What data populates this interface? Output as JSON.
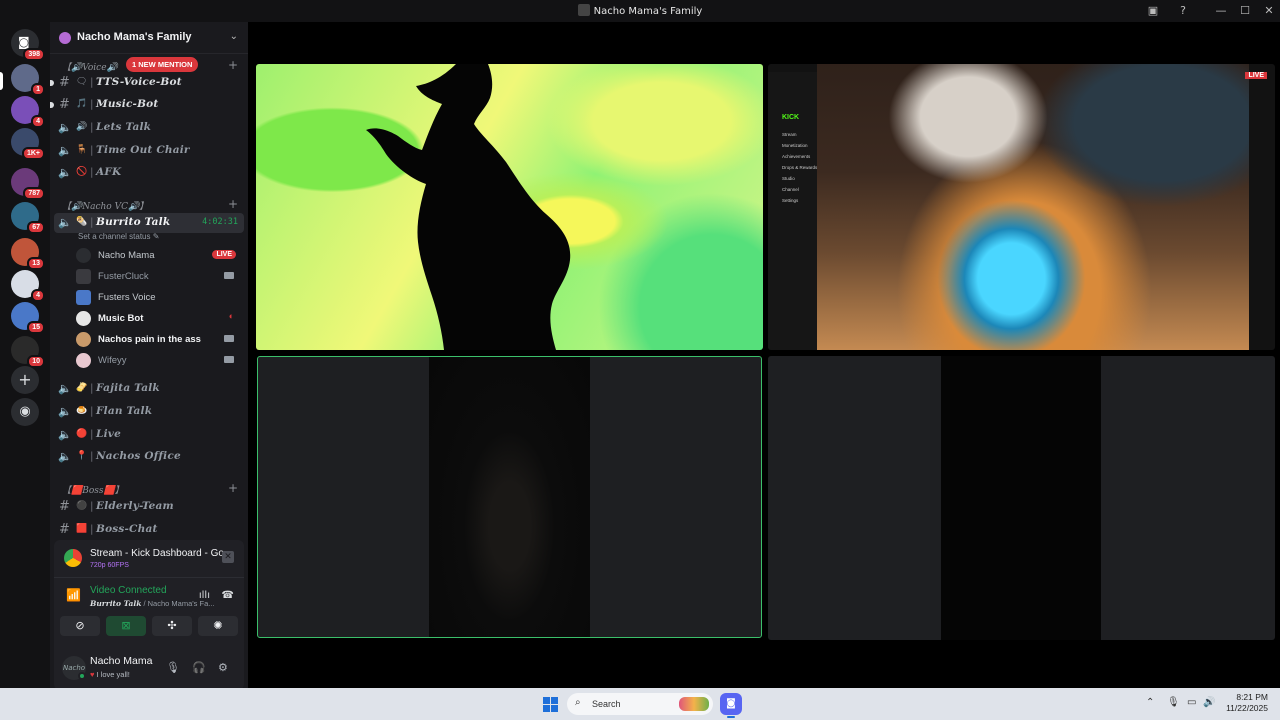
{
  "window": {
    "title": "Nacho Mama's Family"
  },
  "guilds": {
    "home_badge": "398",
    "items": [
      {
        "badge": "1",
        "color": "#5f6a8a"
      },
      {
        "badge": "4",
        "color": "#7a4fb8"
      },
      {
        "badge": "1K+",
        "color": "#3a4a6b"
      },
      {
        "badge": "787",
        "color": "#6b3a7a"
      },
      {
        "badge": "67",
        "color": "#2f6b8a"
      },
      {
        "badge": "13",
        "color": "#c0553a"
      },
      {
        "badge": "4",
        "color": "#d8dde6"
      },
      {
        "badge": "15",
        "color": "#4a78c8"
      },
      {
        "badge": "10",
        "color": "#2a2a2a"
      }
    ]
  },
  "server": {
    "name": "Nacho Mama's Family"
  },
  "categories": {
    "voice": "【🔊Voice🔊",
    "nacho_vc": "【🔊Nacho VC🔊】",
    "boss": "【🟥Boss🟥】"
  },
  "mention_badge": "1 NEW MENTION",
  "channels": {
    "tts": {
      "name": "TTS-Voice-Bot",
      "emoji": "🗨"
    },
    "music": {
      "name": "Music-Bot",
      "emoji": "🎵"
    },
    "lets_talk": {
      "name": "Lets Talk",
      "emoji": "🔊"
    },
    "time_out": {
      "name": "Time Out Chair",
      "emoji": "🪑"
    },
    "afk": {
      "name": "AFK",
      "emoji": "🚫"
    },
    "burrito": {
      "name": "Burrito Talk",
      "emoji": "🌯",
      "timer": "4:02:31",
      "status": "Set a channel status"
    },
    "fajita": {
      "name": "Fajita Talk",
      "emoji": "🫔"
    },
    "flan": {
      "name": "Flan Talk",
      "emoji": "🍮"
    },
    "live": {
      "name": "Live",
      "emoji": "🔴"
    },
    "nachos_office": {
      "name": "Nachos Office",
      "emoji": "📍"
    },
    "elderly": {
      "name": "Elderly-Team",
      "emoji": "⚫"
    },
    "boss_chat": {
      "name": "Boss-Chat",
      "emoji": "🟥"
    }
  },
  "voice_users": [
    {
      "name": "Nacho Mama",
      "live": "LIVE"
    },
    {
      "name": "FusterCluck"
    },
    {
      "name": "Fusters Voice"
    },
    {
      "name": "Music Bot"
    },
    {
      "name": "Nachos pain in the ass"
    },
    {
      "name": "Wifeyy"
    }
  ],
  "stream": {
    "title": "Stream - Kick Dashboard - Google ...",
    "quality": "720p 60FPS"
  },
  "voice_status": {
    "label": "Video Connected",
    "channel": "Burrito Talk",
    "server": " / Nacho Mama's Fa..."
  },
  "user": {
    "name": "Nacho Mama",
    "status": "I love yall!",
    "avatar_text": "Nacho"
  },
  "kick": {
    "logo": "KICK",
    "menu": [
      "Stream",
      "Monetization",
      "Achievements",
      "Drops & Rewards",
      "Studio",
      "Channel",
      "Settings"
    ],
    "live": "LIVE"
  },
  "taskbar": {
    "search_placeholder": "Search",
    "time": "8:21 PM",
    "date": "11/22/2025"
  }
}
